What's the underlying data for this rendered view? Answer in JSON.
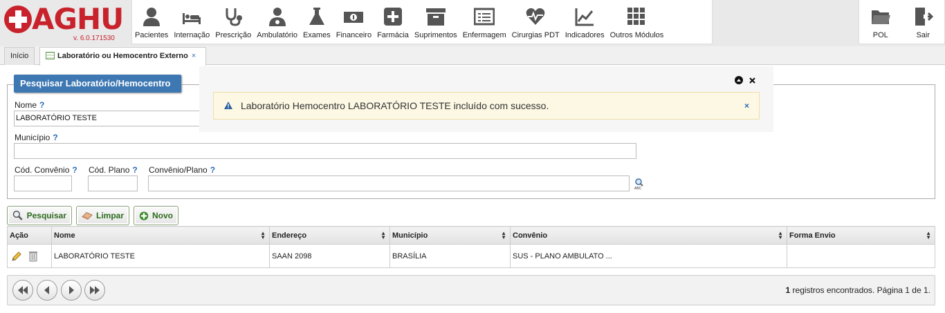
{
  "app": {
    "name": "AGHU",
    "version": "v. 6.0.171530"
  },
  "modules": [
    {
      "label": "Pacientes",
      "icon": "person-icon"
    },
    {
      "label": "Internação",
      "icon": "bed-icon"
    },
    {
      "label": "Prescrição",
      "icon": "stethoscope-icon"
    },
    {
      "label": "Ambulatório",
      "icon": "doctor-icon"
    },
    {
      "label": "Exames",
      "icon": "flask-icon"
    },
    {
      "label": "Financeiro",
      "icon": "money-icon"
    },
    {
      "label": "Farmácia",
      "icon": "plus-box-icon"
    },
    {
      "label": "Suprimentos",
      "icon": "archive-icon"
    },
    {
      "label": "Enfermagem",
      "icon": "list-icon"
    },
    {
      "label": "Cirurgias PDT",
      "icon": "heartbeat-icon"
    },
    {
      "label": "Indicadores",
      "icon": "chart-icon"
    },
    {
      "label": "Outros Módulos",
      "icon": "grid-icon"
    }
  ],
  "right_modules": [
    {
      "label": "POL",
      "icon": "folder-icon"
    },
    {
      "label": "Sair",
      "icon": "exit-icon"
    }
  ],
  "tabs": [
    {
      "label": "Início"
    },
    {
      "label": "Laboratório ou Hemocentro Externo",
      "close": "×"
    }
  ],
  "form": {
    "title": "Pesquisar Laboratório/Hemocentro",
    "help": "?",
    "nome_label": "Nome",
    "nome_value": "LABORATÓRIO TESTE",
    "municipio_label": "Município",
    "municipio_value": "",
    "cod_convenio_label": "Cód. Convênio",
    "cod_plano_label": "Cód. Plano",
    "convenio_plano_label": "Convênio/Plano",
    "lookup_icon": "search-abc-icon"
  },
  "buttons": {
    "pesquisar": "Pesquisar",
    "limpar": "Limpar",
    "novo": "Novo"
  },
  "table": {
    "columns": [
      "Ação",
      "Nome",
      "Endereço",
      "Município",
      "Convênio",
      "Forma Envio"
    ],
    "rows": [
      {
        "nome": "LABORATÓRIO TESTE",
        "endereco": "SAAN 2098",
        "municipio": "BRASÍLIA",
        "convenio": "SUS - PLANO AMBULATO ...",
        "forma_envio": ""
      }
    ]
  },
  "pager": {
    "count": "1",
    "info": " registros encontrados. Página 1 de 1."
  },
  "message": {
    "text": "Laboratório Hemocentro LABORATÓRIO TESTE incluído com sucesso.",
    "type": "warning",
    "close": "×"
  },
  "colors": {
    "brand": "#c8232c",
    "legend": "#3e78b3",
    "button_text": "#2d6b1e",
    "message_bg": "#fcf8e3"
  }
}
